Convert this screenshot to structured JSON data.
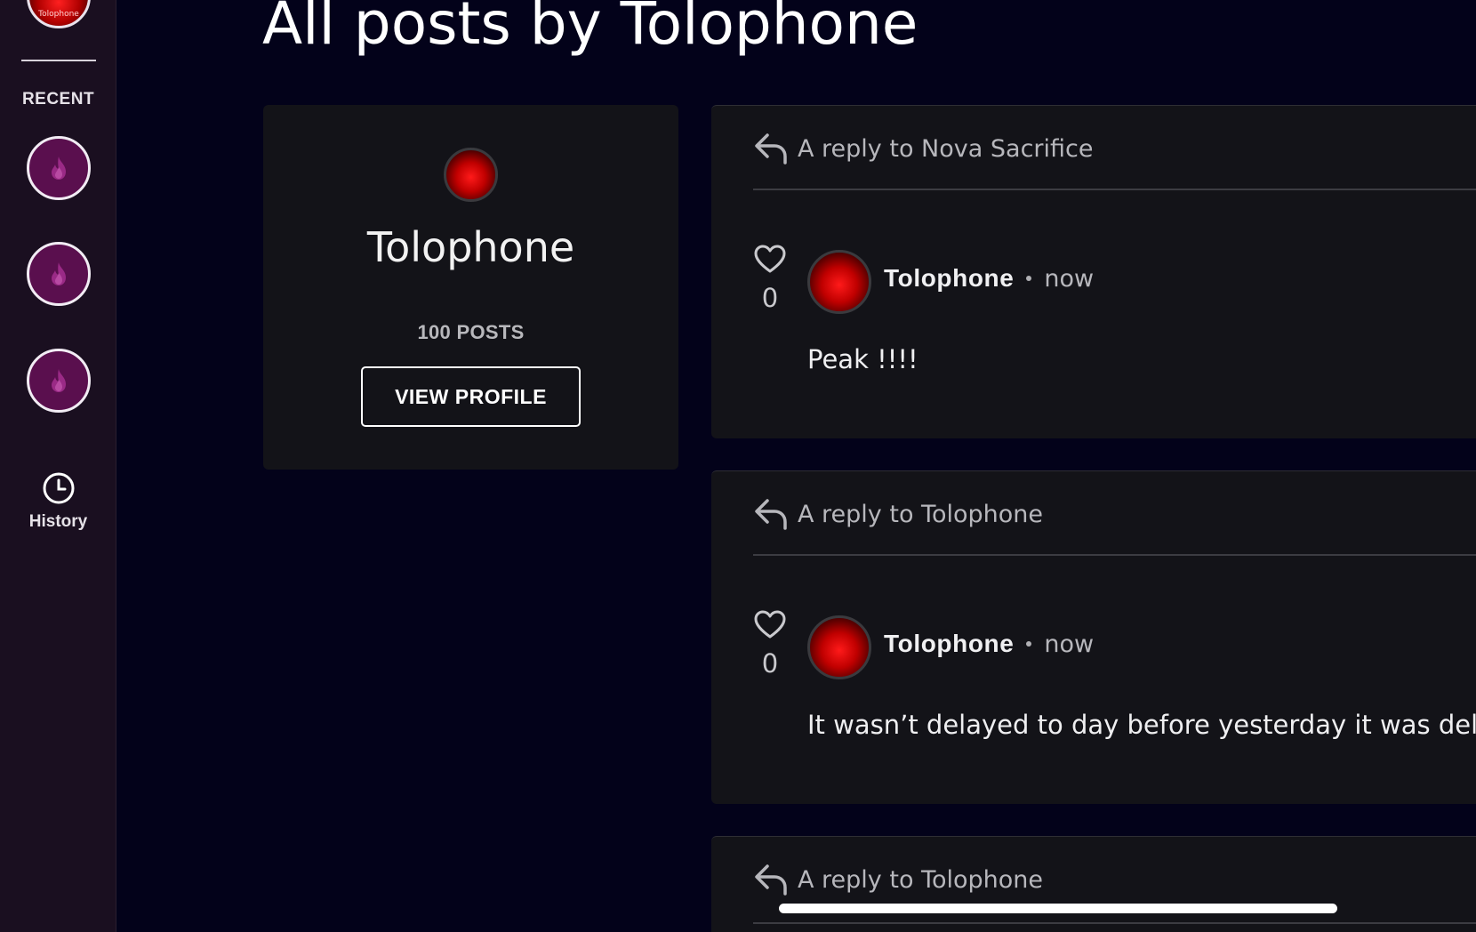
{
  "sidebar": {
    "top_avatar_caption": "Tolophone",
    "recent_label": "RECENT",
    "recent_items": [
      {
        "icon": "flame-icon"
      },
      {
        "icon": "flame-icon"
      },
      {
        "icon": "flame-icon"
      }
    ],
    "history_label": "History"
  },
  "page_title": "All posts by Tolophone",
  "profile": {
    "name": "Tolophone",
    "posts_count": "100 POSTS",
    "view_profile_label": "VIEW PROFILE"
  },
  "posts": [
    {
      "reply_to": "A reply to Nova Sacrifice",
      "likes": "0",
      "author": "Tolophone",
      "time": "now",
      "body": "Peak !!!!"
    },
    {
      "reply_to": "A reply to Tolophone",
      "likes": "0",
      "author": "Tolophone",
      "time": "now",
      "body": "It wasn’t delayed to day before yesterday it was dela"
    },
    {
      "reply_to": "A reply to Tolophone"
    }
  ],
  "colors": {
    "background": "#03021a",
    "sidebar": "#1a0f20",
    "card": "#131318",
    "recent_item_fill": "#5a0f4e"
  }
}
